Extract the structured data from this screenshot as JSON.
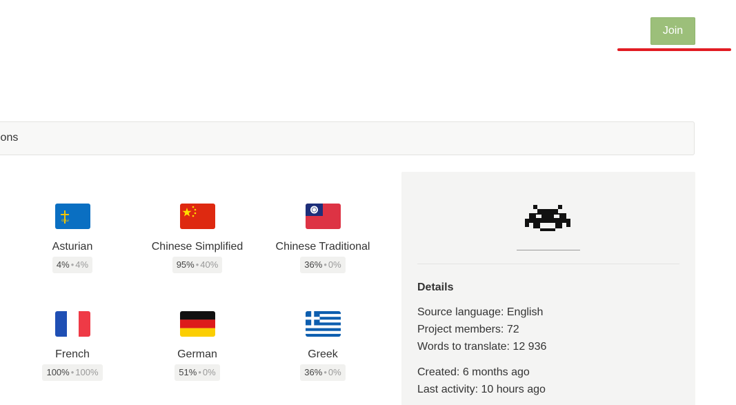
{
  "header": {
    "join_label": "Join"
  },
  "tab_bar": {
    "visible_label": "ions"
  },
  "languages": [
    {
      "name": "Asturian",
      "stat_primary": "4%",
      "stat_secondary": "4%",
      "flag_icon": "flag-asturias-icon"
    },
    {
      "name": "Chinese Simplified",
      "stat_primary": "95%",
      "stat_secondary": "40%",
      "flag_icon": "flag-china-icon"
    },
    {
      "name": "Chinese Traditional",
      "stat_primary": "36%",
      "stat_secondary": "0%",
      "flag_icon": "flag-taiwan-icon"
    },
    {
      "name": "French",
      "stat_primary": "100%",
      "stat_secondary": "100%",
      "flag_icon": "flag-france-icon"
    },
    {
      "name": "German",
      "stat_primary": "51%",
      "stat_secondary": "0%",
      "flag_icon": "flag-germany-icon"
    },
    {
      "name": "Greek",
      "stat_primary": "36%",
      "stat_secondary": "0%",
      "flag_icon": "flag-greece-icon"
    }
  ],
  "sidebar": {
    "logo_icon": "space-invader-logo-icon",
    "details_title": "Details",
    "source_language": "Source language: English",
    "project_members": "Project members: 72",
    "words_to_translate": "Words to translate: 12 936",
    "created": "Created: 6 months ago",
    "last_activity": "Last activity: 10 hours ago"
  },
  "colors": {
    "join_button": "#9cbf7a",
    "annotation_underline": "#e21c23",
    "sidebar_background": "#f4f4f3"
  }
}
